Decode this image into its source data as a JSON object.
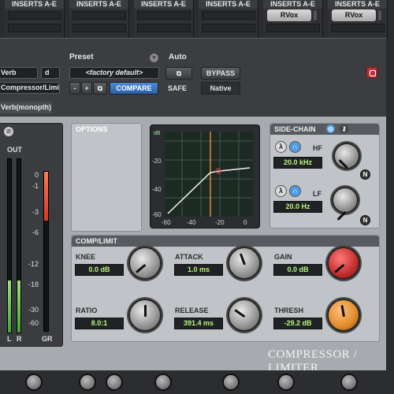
{
  "mixer": {
    "insert_header": "INSERTS A-E",
    "slot_label": "RVox"
  },
  "header": {
    "preset_title": "Preset",
    "auto_title": "Auto",
    "track_name": "Verb",
    "track_channel": "d",
    "plugin_name": "Compressor/Limiter",
    "preset_value": "<factory default>",
    "compare_label": "COMPARE",
    "bypass_label": "BYPASS",
    "safe_label": "SAFE",
    "native_label": "Native",
    "sidechain_key": "Verb(monopth)"
  },
  "meters": {
    "out_label": "OUT",
    "scale": [
      "0",
      "-1",
      "-3",
      "-6",
      "-12",
      "-18",
      "-30",
      "-60"
    ],
    "l_label": "L",
    "r_label": "R",
    "gr_label": "GR",
    "left_level": 0.3,
    "right_level": 0.3
  },
  "options": {
    "title": "OPTIONS"
  },
  "graph": {
    "y_ticks": [
      "-20",
      "-40",
      "-60"
    ],
    "x_ticks": [
      "-60",
      "-40",
      "-20",
      "0"
    ],
    "top_tick": "dB"
  },
  "sidechain": {
    "title": "SIDE-CHAIN",
    "hf_label": "HF",
    "hf_value": "20.0 kHz",
    "lf_label": "LF",
    "lf_value": "20.0 Hz"
  },
  "comp": {
    "title": "COMP/LIMIT",
    "knee_label": "KNEE",
    "knee_value": "0.0 dB",
    "attack_label": "ATTACK",
    "attack_value": "1.0 ms",
    "gain_label": "GAIN",
    "gain_value": "0.0 dB",
    "ratio_label": "RATIO",
    "ratio_value": "8.0:1",
    "release_label": "RELEASE",
    "release_value": "391.4 ms",
    "thresh_label": "THRESH",
    "thresh_value": "-29.2 dB"
  },
  "footer": {
    "title": "COMPRESSOR / LIMITER"
  },
  "colors": {
    "value_text": "#b7f77d",
    "compare": "#3d7bd0",
    "gain_knob": "#d43a3a",
    "thresh_knob": "#e89a3a"
  }
}
